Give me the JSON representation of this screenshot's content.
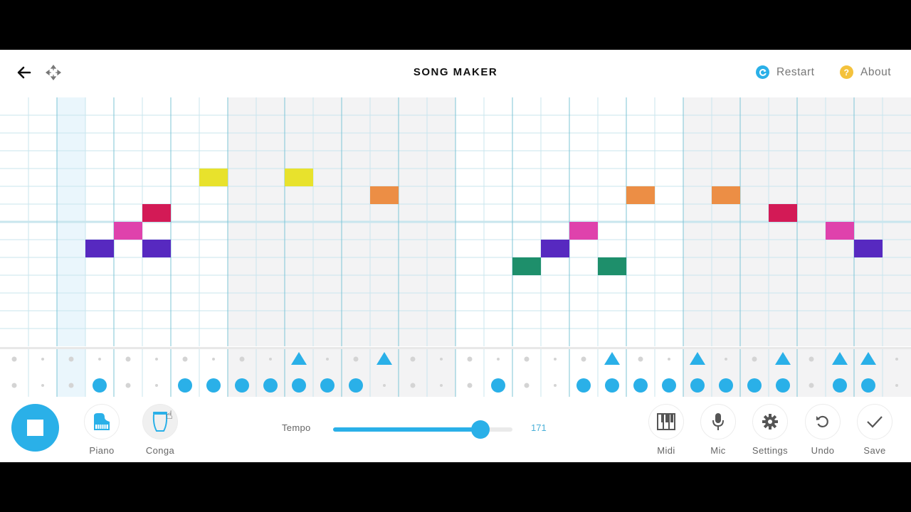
{
  "header": {
    "title": "SONG MAKER",
    "restart_label": "Restart",
    "about_label": "About",
    "back_icon": "arrow-left-icon",
    "move_icon": "move-arrows-icon",
    "restart_icon": "restart-icon",
    "about_icon": "question-icon"
  },
  "colors": {
    "accent": "#2ab0e8",
    "grid_line": "#c8e6ee",
    "beat_line": "#7cc4d6",
    "shade": "#f3f3f4",
    "playhead": "#eaf6fc"
  },
  "grid": {
    "columns": 32,
    "melody_rows": 14,
    "beats_per_bar": 8,
    "shaded_bars": [
      1,
      3
    ],
    "octave_boundary_row": 7,
    "playhead_column": 2,
    "notes": [
      {
        "col": 3,
        "row": 8,
        "color": "#5729c0"
      },
      {
        "col": 4,
        "row": 7,
        "color": "#df42ac"
      },
      {
        "col": 5,
        "row": 6,
        "color": "#d31a56"
      },
      {
        "col": 5,
        "row": 8,
        "color": "#5729c0"
      },
      {
        "col": 7,
        "row": 4,
        "color": "#e8e22c"
      },
      {
        "col": 10,
        "row": 4,
        "color": "#e8e22c"
      },
      {
        "col": 13,
        "row": 5,
        "color": "#ec8e45"
      },
      {
        "col": 18,
        "row": 9,
        "color": "#1e8f6b"
      },
      {
        "col": 19,
        "row": 8,
        "color": "#5729c0"
      },
      {
        "col": 20,
        "row": 7,
        "color": "#df42ac"
      },
      {
        "col": 21,
        "row": 9,
        "color": "#1e8f6b"
      },
      {
        "col": 22,
        "row": 5,
        "color": "#ec8e45"
      },
      {
        "col": 25,
        "row": 5,
        "color": "#ec8e45"
      },
      {
        "col": 27,
        "row": 6,
        "color": "#d31a56"
      },
      {
        "col": 29,
        "row": 7,
        "color": "#df42ac"
      },
      {
        "col": 30,
        "row": 8,
        "color": "#5729c0"
      }
    ],
    "percussion": {
      "triangles": [
        10,
        13,
        21,
        24,
        27,
        29,
        30
      ],
      "circles": [
        3,
        6,
        7,
        8,
        9,
        10,
        11,
        12,
        17,
        20,
        21,
        22,
        23,
        24,
        25,
        26,
        27,
        29,
        30
      ]
    }
  },
  "footer": {
    "play_icon": "stop-icon",
    "instrument_label": "Piano",
    "instrument_icon": "piano-icon",
    "percussion_label": "Conga",
    "percussion_icon": "conga-icon",
    "tempo_label": "Tempo",
    "tempo_value": "171",
    "tempo_fraction": 0.82,
    "tools": [
      {
        "label": "Midi",
        "icon": "piano-keys-icon"
      },
      {
        "label": "Mic",
        "icon": "microphone-icon"
      },
      {
        "label": "Settings",
        "icon": "gear-icon"
      },
      {
        "label": "Undo",
        "icon": "undo-icon"
      },
      {
        "label": "Save",
        "icon": "checkmark-icon"
      }
    ]
  }
}
